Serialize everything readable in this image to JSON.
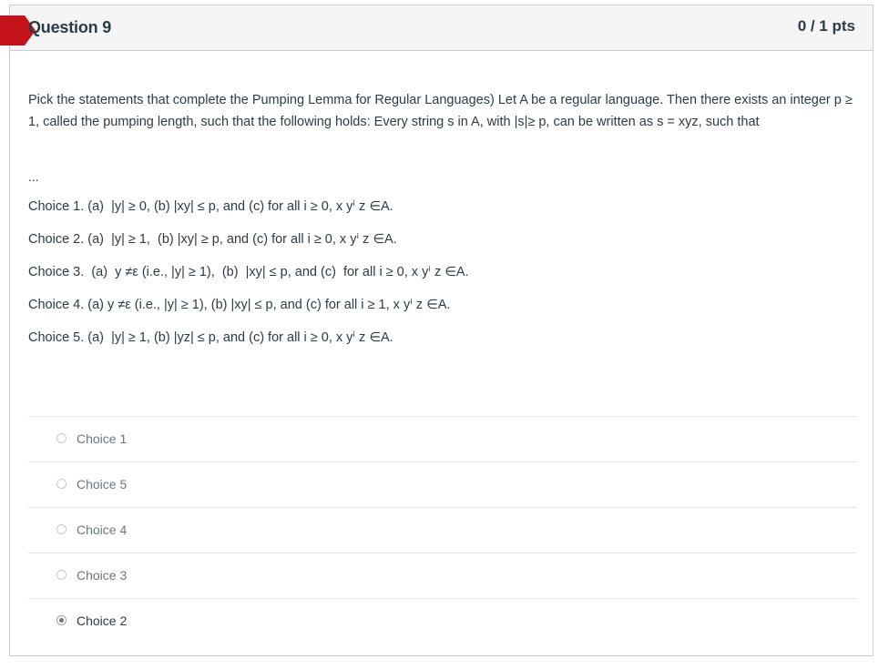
{
  "question": {
    "title": "Question 9",
    "points": "0 / 1 pts",
    "text": "Pick the statements that complete the Pumping Lemma for Regular Languages) Let A be a regular language. Then there exists an integer p ≥ 1, called the pumping length, such that the following holds: Every string s in A, with |s|≥  p, can be written as s = xyz, such that",
    "ellipsis": "...",
    "choices": [
      "Choice 1. (a)  |y| ≥ 0, (b) |xy| ≤ p, and (c) for all i ≥ 0, x yⁱ z ∈A.",
      "Choice 2. (a)  |y| ≥ 1,  (b) |xy| ≥ p, and (c) for all i ≥ 0, x yⁱ z ∈A.",
      "Choice 3.  (a)  y ≠ε (i.e., |y| ≥ 1),  (b)  |xy| ≤ p, and (c)  for all i ≥ 0, x yⁱ z ∈A.",
      "Choice 4. (a) y ≠ε (i.e., |y| ≥ 1), (b) |xy| ≤ p, and (c) for all i ≥ 1, x yⁱ z ∈A.",
      "Choice 5. (a)  |y| ≥ 1, (b) |yz| ≤ p, and (c) for all i ≥ 0, x yⁱ z ∈A."
    ]
  },
  "answers": [
    {
      "label": "Choice 1",
      "selected": false
    },
    {
      "label": "Choice 5",
      "selected": false
    },
    {
      "label": "Choice 4",
      "selected": false
    },
    {
      "label": "Choice 3",
      "selected": false
    },
    {
      "label": "Choice 2",
      "selected": true
    }
  ],
  "colors": {
    "flag": "#c4131a",
    "border": "#c7cdd1",
    "header_bg": "#f5f5f5",
    "text": "#2d3b45"
  }
}
